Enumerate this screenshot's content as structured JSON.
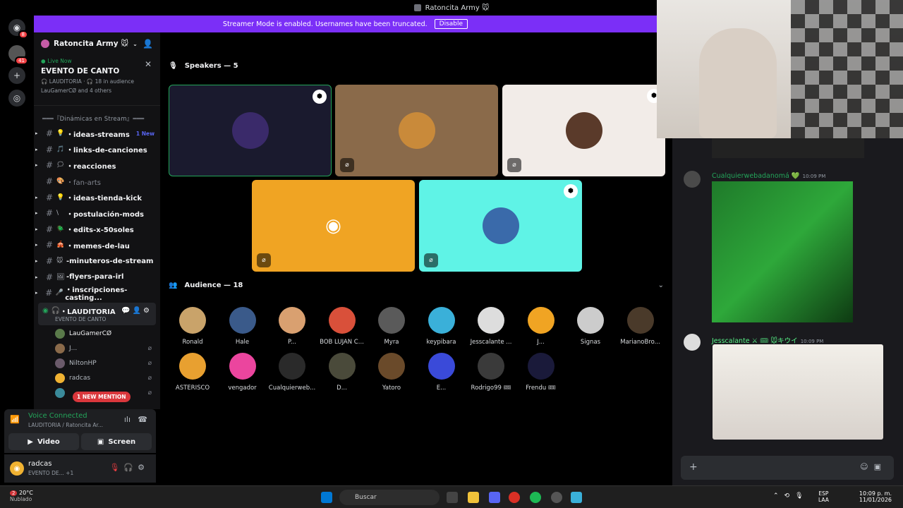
{
  "window": {
    "title": "Ratoncita Army 🐭"
  },
  "rail": {
    "home_badge": "8",
    "server_badge": "41"
  },
  "banner": {
    "text": "Streamer Mode is enabled. Usernames have been truncated.",
    "button": "Disable"
  },
  "server": {
    "name": "Ratoncita Army 🐭"
  },
  "event": {
    "live_label": "Live Now",
    "title": "EVENTO DE CANTO",
    "meta": "🎧 LAUDITORIA · 🎧 18 in audience",
    "attendees": "LauGamerCØ and 4 others"
  },
  "category": "═══『Dinámicas en Stream』═══",
  "channels": [
    {
      "emoji": "💡",
      "name": "・ideas-streams",
      "badge": "1 New",
      "unread": true
    },
    {
      "emoji": "🎵",
      "name": "・links-de-canciones",
      "unread": true
    },
    {
      "emoji": "🗯",
      "name": "・reacciones",
      "unread": true
    },
    {
      "emoji": "🎨",
      "name": "・fan-arts",
      "unread": false
    },
    {
      "emoji": "💡",
      "name": "・ideas-tienda-kick",
      "unread": true
    },
    {
      "emoji": "\\",
      "name": "・postulación-mods",
      "unread": true
    },
    {
      "emoji": "🪲",
      "name": "・edits-x-50soles",
      "unread": true
    },
    {
      "emoji": "🎪",
      "name": "・memes-de-lau",
      "unread": true
    },
    {
      "emoji": "🐭",
      "name": "-minuteros-de-stream",
      "unread": true
    },
    {
      "emoji": "🖼",
      "name": "-flyers-para-irl",
      "unread": true
    },
    {
      "emoji": "🎤",
      "name": "・inscripciones-casting...",
      "unread": true
    }
  ],
  "voice_channel": {
    "name": "・LAUDITORIA",
    "subtitle": "EVENTO DE CANTO"
  },
  "voice_users": [
    {
      "name": "LauGamerCØ",
      "color": "#5a7a4a",
      "live": true
    },
    {
      "name": "J...",
      "color": "#8a6a4a",
      "live": false
    },
    {
      "name": "NiltonHP",
      "color": "#6a5a6a",
      "live": false
    },
    {
      "name": "radcas",
      "color": "#f0b232",
      "live": false
    },
    {
      "name": "",
      "color": "#3a8a9a",
      "live": false
    }
  ],
  "mention_pill": "1 NEW MENTION",
  "voice_panel": {
    "status": "Voice Connected",
    "location": "LAUDITORIA / Ratoncita Ar...",
    "video": "Video",
    "screen": "Screen"
  },
  "user_panel": {
    "name": "radcas",
    "status": "EVENTO DE...",
    "extra": "+1"
  },
  "stage": {
    "speakers_title": "Speakers — 5",
    "audience_title": "Audience — 18",
    "speakers": [
      {
        "bg": "#1a1a2e",
        "avatar": "#3a2a6a",
        "moderator": true,
        "muted": false,
        "active": true
      },
      {
        "bg": "#8a6a4a",
        "avatar": "#c98a3a",
        "moderator": false,
        "muted": true,
        "active": false
      },
      {
        "bg": "#f2ece8",
        "avatar": "#5a3a2a",
        "moderator": true,
        "muted": true,
        "active": false
      },
      {
        "bg": "#f0a423",
        "avatar": "discord",
        "moderator": false,
        "muted": true,
        "active": false
      },
      {
        "bg": "#5ff3e6",
        "avatar": "#3a6aaa",
        "moderator": true,
        "muted": true,
        "active": false
      }
    ],
    "audience": [
      {
        "name": "Ronald",
        "color": "#c9a36a"
      },
      {
        "name": "Hale",
        "color": "#3a5a8a"
      },
      {
        "name": "P...",
        "color": "#d9a070"
      },
      {
        "name": "BOB LUJAN C...",
        "color": "#d9503a"
      },
      {
        "name": "Myra",
        "color": "#5a5a5a"
      },
      {
        "name": "keypibara",
        "color": "#3ab0d9"
      },
      {
        "name": "Jesscalante ...",
        "color": "#dddddd"
      },
      {
        "name": "J...",
        "color": "#f0a423"
      },
      {
        "name": "Signas",
        "color": "#cccccc"
      },
      {
        "name": "MarianoBro...",
        "color": "#4a3a2a"
      },
      {
        "name": "ASTERISCO",
        "color": "#e8a030"
      },
      {
        "name": "vengador",
        "color": "#eb459e"
      },
      {
        "name": "Cualquierweb...",
        "color": "#2a2a2a"
      },
      {
        "name": "D...",
        "color": "#4a4a3a"
      },
      {
        "name": "Yatoro",
        "color": "#6a4a2a"
      },
      {
        "name": "E...",
        "color": "#3a4ad9"
      },
      {
        "name": "Rodrigo99 🎟",
        "color": "#3a3a3a"
      },
      {
        "name": "Frendu 🎟",
        "color": "#1a1a3a"
      }
    ]
  },
  "chat": {
    "messages": [
      {
        "author": "Cualquierwebadanomá 💚",
        "author_color": "#23a55a",
        "time": "10:09 PM"
      },
      {
        "author": "Jesscalante ⚔ 🎟 🐭キウイ",
        "author_color": "#57f287",
        "time": "10:09 PM"
      }
    ]
  },
  "taskbar": {
    "temp": "20°C",
    "weather": "Nublado",
    "search": "Buscar",
    "lang": "ESP",
    "layout": "LAA",
    "time": "10:09 p. m.",
    "date": "11/01/2026",
    "notif": "2"
  }
}
